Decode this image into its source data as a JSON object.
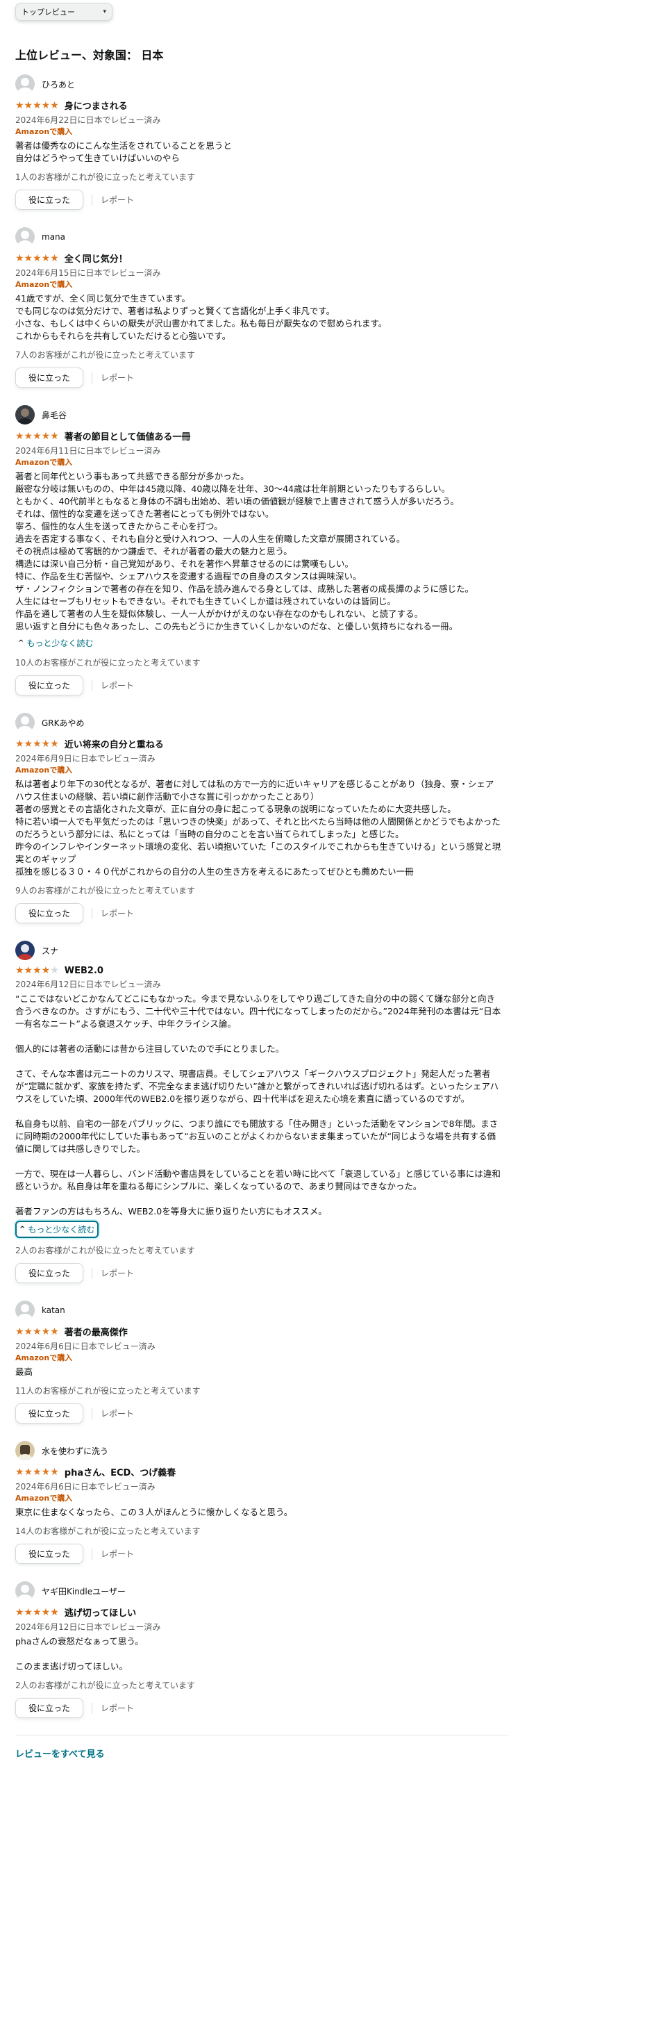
{
  "sort": {
    "selected": "トップレビュー"
  },
  "heading": "上位レビュー、対象国： 日本",
  "reviews": [
    {
      "name": "ひろあと",
      "stars": 5,
      "title": "身につまされる",
      "date": "2024年6月22日に日本でレビュー済み",
      "verified": "Amazonで購入",
      "body": [
        "著者は優秀なのにこんな生活をされていることを思うと",
        "自分はどうやって生きていけばいいのやら"
      ],
      "helpful": "1人のお客様がこれが役に立ったと考えています",
      "helpful_label": "役に立った",
      "report_label": "レポート"
    },
    {
      "name": "mana",
      "stars": 5,
      "title": "全く同じ気分！",
      "date": "2024年6月15日に日本でレビュー済み",
      "verified": "Amazonで購入",
      "body": [
        "41歳ですが、全く同じ気分で生きています。",
        "でも同じなのは気分だけで、著者は私よりずっと賢くて言語化が上手く非凡です。",
        "小さな、もしくは中くらいの厭失が沢山書かれてました。私も毎日が厭失なので慰められます。",
        "これからもそれらを共有していただけると心強いです。"
      ],
      "helpful": "7人のお客様がこれが役に立ったと考えています",
      "helpful_label": "役に立った",
      "report_label": "レポート"
    },
    {
      "name": "鼻毛谷",
      "stars": 5,
      "title": "著者の節目として価値ある一冊",
      "date": "2024年6月11日に日本でレビュー済み",
      "verified": "Amazonで購入",
      "body": [
        "著者と同年代という事もあって共感できる部分が多かった。",
        "厳密な分岐は無いものの、中年は45歳以降、40歳以降を壮年、30〜44歳は壮年前期といったりもするらしい。",
        "ともかく、40代前半ともなると身体の不調も出始め、若い頃の価値観が経験で上書きされて惑う人が多いだろう。",
        "それは、個性的な変遷を送ってきた著者にとっても例外ではない。",
        "寧ろ、個性的な人生を送ってきたからこそ心を打つ。",
        "過去を否定する事なく、それも自分と受け入れつつ、一人の人生を俯瞰した文章が展開されている。",
        "その視点は極めて客観的かつ謙虚で、それが著者の最大の魅力と思う。",
        "構造には深い自己分析・自己覚知があり、それを著作へ昇華させるのには驚嘆もしい。",
        "特に、作品を生む苦悩や、シェアハウスを変遷する過程での自身のスタンスは興味深い。",
        "ザ・ノンフィクションで著者の存在を知り、作品を読み進んでる身としては、成熟した著者の成長譚のように感じた。",
        "人生にはセーブもリセットもできない。それでも生きていくしか道は残されていないのは皆同じ。",
        "作品を通して著者の人生を疑似体験し、一人一人がかけがえのない存在なのかもしれない、と読了する。",
        "思い返すと自分にも色々あったし、この先もどうにか生きていくしかないのだな、と優しい気持ちになれる一冊。"
      ],
      "read_less": "もっと少なく読む",
      "helpful": "10人のお客様がこれが役に立ったと考えています",
      "helpful_label": "役に立った",
      "report_label": "レポート"
    },
    {
      "name": "GRKあやめ",
      "stars": 5,
      "title": "近い将来の自分と重ねる",
      "date": "2024年6月9日に日本でレビュー済み",
      "verified": "Amazonで購入",
      "body": [
        "私は著者より年下の30代となるが、著者に対しては私の方で一方的に近いキャリアを感じることがあり（独身、寮・シェアハウス住まいの経験、若い頃に創作活動で小さな賞に引っかかったことあり）",
        "著者の感覚とその言語化された文章が、正に自分の身に起こってる現象の説明になっていたために大変共感した。",
        "特に若い頃一人でも平気だったのは「思いつきの快楽」があって、それと比べたら当時は他の人間関係とかどうでもよかったのだろうという部分には、私にとっては「当時の自分のことを言い当てられてしまった」と感じた。",
        "昨今のインフレやインターネット環境の変化、若い頃抱いていた「このスタイルでこれからも生きていける」という感覚と現実とのギャップ",
        "孤独を感じる３０・４０代がこれからの自分の人生の生き方を考えるにあたってぜひとも薦めたい一冊"
      ],
      "helpful": "9人のお客様がこれが役に立ったと考えています",
      "helpful_label": "役に立った",
      "report_label": "レポート"
    },
    {
      "name": "スナ",
      "stars": 4,
      "title": "WEB2.0",
      "date": "2024年6月12日に日本でレビュー済み",
      "verified": "",
      "body": [
        "“ここではないどこかなんてどこにもなかった。今まで見ないふりをしてやり過ごしてきた自分の中の弱くて嫌な部分と向き合うべきなのか。さすがにもう、二十代や三十代ではない。四十代になってしまったのだから。”2024年発刊の本書は元“日本一有名なニート”よる衰退スケッチ、中年クライシス論。",
        "",
        "個人的には著者の活動には昔から注目していたので手にとりました。",
        "",
        "さて、そんな本書は元ニートのカリスマ、現書店員。そしてシェアハウス「ギークハウスプロジェクト」発起人だった著者が“定職に就かず、家族を持たず、不完全なまま逃げ切りたい”誰かと繋がってきれいれば逃げ切れるはず。といったシェアハウスをしていた頃、2000年代のWEB2.0を振り返りながら、四十代半ばを迎えた心境を素直に語っているのですが。",
        "",
        "私自身も以前、自宅の一部をパブリックに、つまり誰にでも開放する「住み開き」といった活動をマンションで8年間。まさに同時期の2000年代にしていた事もあって“お互いのことがよくわからないまま集まっていたが“同じような場を共有する価値に関しては共感しきりでした。",
        "",
        "一方で、現在は一人暮らし、バンド活動や書店員をしていることを若い時に比べて「衰退している」と感じている事には違和感というか。私自身は年を重ねる毎にシンプルに、楽しくなっているので、あまり賛同はできなかった。",
        "",
        "著者ファンの方はもちろん、WEB2.0を等身大に振り返りたい方にもオススメ。"
      ],
      "read_less": "もっと少なく読む",
      "helpful": "2人のお客様がこれが役に立ったと考えています",
      "helpful_label": "役に立った",
      "report_label": "レポート"
    },
    {
      "name": "katan",
      "stars": 5,
      "title": "著者の最高傑作",
      "date": "2024年6月6日に日本でレビュー済み",
      "verified": "Amazonで購入",
      "body": [
        "最高"
      ],
      "helpful": "11人のお客様がこれが役に立ったと考えています",
      "helpful_label": "役に立った",
      "report_label": "レポート"
    },
    {
      "name": "水を使わずに洗う",
      "stars": 5,
      "title": "phaさん、ECD、つげ義春",
      "date": "2024年6月6日に日本でレビュー済み",
      "verified": "Amazonで購入",
      "body": [
        "東京に住まなくなったら、この３人がほんとうに懐かしくなると思う。"
      ],
      "helpful": "14人のお客様がこれが役に立ったと考えています",
      "helpful_label": "役に立った",
      "report_label": "レポート"
    },
    {
      "name": "ヤギ田Kindleユーザー",
      "stars": 5,
      "title": "逃げ切ってほしい",
      "date": "2024年6月12日に日本でレビュー済み",
      "verified": "",
      "body": [
        "phaさんの衰怒だなぁって思う。",
        "",
        "このまま逃げ切ってほしい。"
      ],
      "helpful": "2人のお客様がこれが役に立ったと考えています",
      "helpful_label": "役に立った",
      "report_label": "レポート"
    }
  ],
  "see_all": "レビューをすべて見る"
}
